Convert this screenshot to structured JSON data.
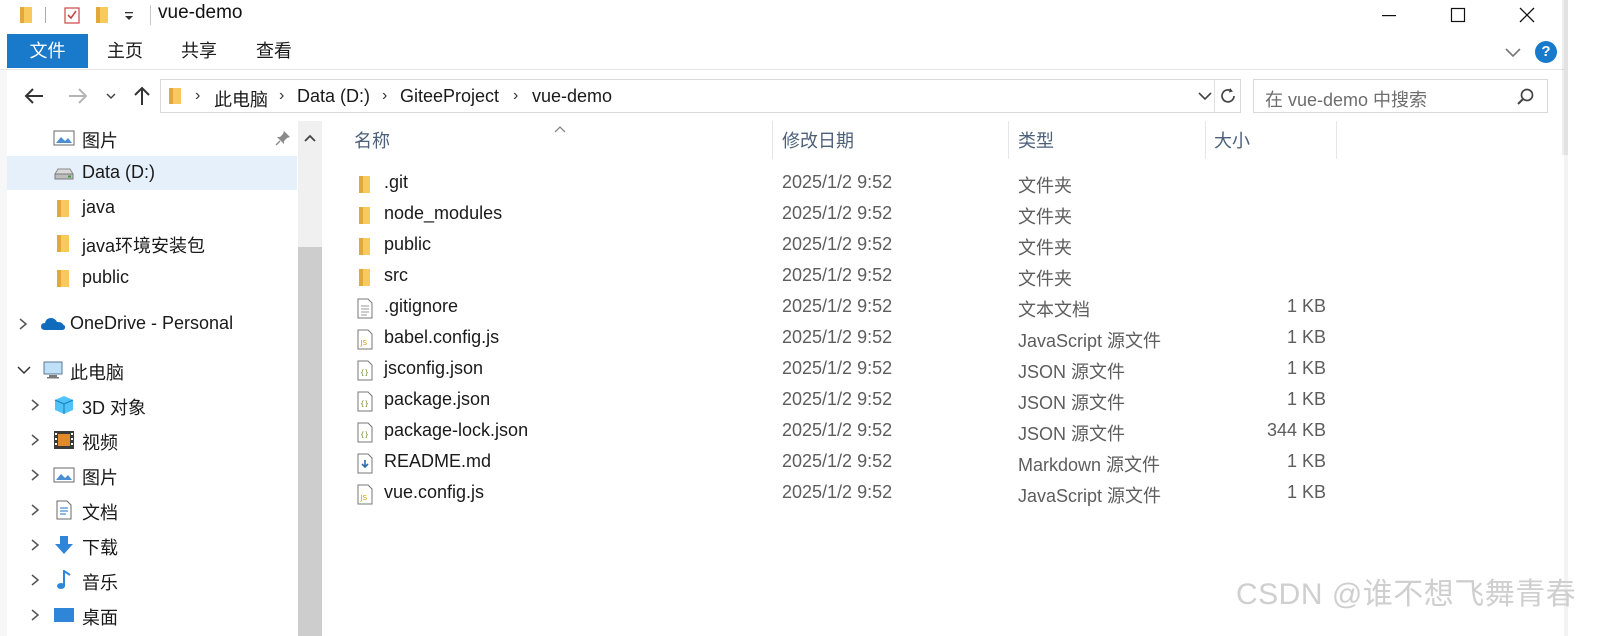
{
  "window": {
    "title": "vue-demo"
  },
  "ribbon": {
    "tabs": [
      "文件",
      "主页",
      "共享",
      "查看"
    ],
    "help_label": "?"
  },
  "address": {
    "breadcrumbs": [
      "此电脑",
      "Data (D:)",
      "GiteeProject",
      "vue-demo"
    ]
  },
  "search": {
    "placeholder": "在 vue-demo 中搜索"
  },
  "nav": {
    "items": [
      {
        "label": "图片",
        "icon": "pictures-icon",
        "pinned": true
      },
      {
        "label": "Data (D:)",
        "icon": "drive-icon",
        "selected": true
      },
      {
        "label": "java",
        "icon": "folder-icon"
      },
      {
        "label": "java环境安装包",
        "icon": "folder-icon"
      },
      {
        "label": "public",
        "icon": "folder-icon"
      },
      {
        "label": "OneDrive - Personal",
        "icon": "onedrive-icon"
      },
      {
        "label": "此电脑",
        "icon": "this-pc-icon"
      },
      {
        "label": "3D 对象",
        "icon": "3d-objects-icon"
      },
      {
        "label": "视频",
        "icon": "videos-icon"
      },
      {
        "label": "图片",
        "icon": "pictures-icon"
      },
      {
        "label": "文档",
        "icon": "documents-icon"
      },
      {
        "label": "下载",
        "icon": "downloads-icon"
      },
      {
        "label": "音乐",
        "icon": "music-icon"
      },
      {
        "label": "桌面",
        "icon": "desktop-icon"
      }
    ]
  },
  "columns": {
    "name": "名称",
    "date": "修改日期",
    "type": "类型",
    "size": "大小"
  },
  "files": [
    {
      "name": ".git",
      "date": "2025/1/2 9:52",
      "type": "文件夹",
      "size": "",
      "icon": "folder-icon"
    },
    {
      "name": "node_modules",
      "date": "2025/1/2 9:52",
      "type": "文件夹",
      "size": "",
      "icon": "folder-icon"
    },
    {
      "name": "public",
      "date": "2025/1/2 9:52",
      "type": "文件夹",
      "size": "",
      "icon": "folder-icon"
    },
    {
      "name": "src",
      "date": "2025/1/2 9:52",
      "type": "文件夹",
      "size": "",
      "icon": "folder-icon"
    },
    {
      "name": ".gitignore",
      "date": "2025/1/2 9:52",
      "type": "文本文档",
      "size": "1 KB",
      "icon": "text-file-icon"
    },
    {
      "name": "babel.config.js",
      "date": "2025/1/2 9:52",
      "type": "JavaScript 源文件",
      "size": "1 KB",
      "icon": "js-file-icon"
    },
    {
      "name": "jsconfig.json",
      "date": "2025/1/2 9:52",
      "type": "JSON 源文件",
      "size": "1 KB",
      "icon": "json-file-icon"
    },
    {
      "name": "package.json",
      "date": "2025/1/2 9:52",
      "type": "JSON 源文件",
      "size": "1 KB",
      "icon": "json-file-icon"
    },
    {
      "name": "package-lock.json",
      "date": "2025/1/2 9:52",
      "type": "JSON 源文件",
      "size": "344 KB",
      "icon": "json-file-icon"
    },
    {
      "name": "README.md",
      "date": "2025/1/2 9:52",
      "type": "Markdown 源文件",
      "size": "1 KB",
      "icon": "markdown-file-icon"
    },
    {
      "name": "vue.config.js",
      "date": "2025/1/2 9:52",
      "type": "JavaScript 源文件",
      "size": "1 KB",
      "icon": "js-file-icon"
    }
  ],
  "watermark": "CSDN @谁不想飞舞青春",
  "colors": {
    "accent": "#1979ca",
    "selection": "#e5f0fb",
    "folder": "#f8c95c"
  }
}
